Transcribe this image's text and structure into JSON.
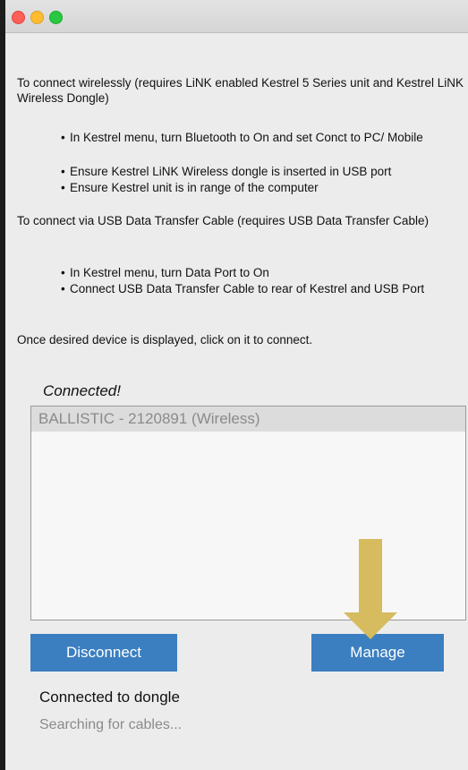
{
  "colors": {
    "button_blue": "#3b7fc0",
    "arrow_gold": "#d6bb5f",
    "window_bg": "#ececec"
  },
  "window": {
    "controls": [
      "close",
      "minimize",
      "zoom"
    ]
  },
  "instructions": {
    "wireless_intro": "To connect wirelessly (requires LiNK enabled Kestrel 5 Series unit and Kestrel LiNK Wireless Dongle)",
    "wireless_bullets": [
      "In Kestrel menu, turn Bluetooth to On and set Conct to PC/ Mobile",
      "Ensure Kestrel LiNK Wireless dongle is inserted in USB port",
      "Ensure Kestrel unit is in range of the computer"
    ],
    "usb_intro": "To connect via USB Data Transfer Cable (requires USB Data Transfer Cable)",
    "usb_bullets": [
      "In Kestrel menu, turn Data Port to On",
      "Connect USB Data Transfer Cable to rear of Kestrel and USB Port"
    ],
    "final_note": "Once desired device is displayed, click on it to connect."
  },
  "connection": {
    "label": "Connected!",
    "devices": [
      "BALLISTIC - 2120891 (Wireless)"
    ]
  },
  "buttons": {
    "disconnect": "Disconnect",
    "manage": "Manage"
  },
  "status": {
    "dongle": "Connected to dongle",
    "cables": "Searching for cables..."
  }
}
